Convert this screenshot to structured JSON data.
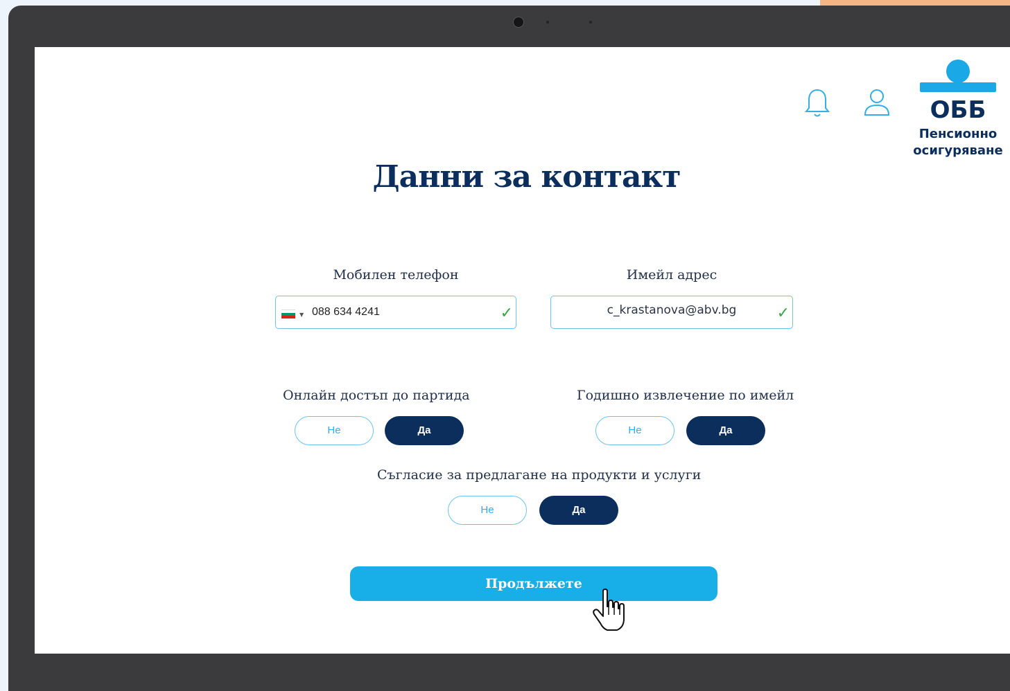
{
  "header": {
    "bell_icon": "bell-icon",
    "user_icon": "user-icon"
  },
  "logo": {
    "brand": "ОББ",
    "line1": "Пенсионно",
    "line2": "осигуряване"
  },
  "page": {
    "title": "Данни за контакт"
  },
  "form": {
    "phone": {
      "label": "Мобилен телефон",
      "value": "088 634 4241",
      "country_flag": "bg-flag-icon"
    },
    "email": {
      "label": "Имейл адрес",
      "value": "c_krastanova@abv.bg"
    },
    "online_access": {
      "label": "Онлайн достъп до партида",
      "no": "Не",
      "yes": "Да",
      "selected": "Да"
    },
    "annual_statement": {
      "label": "Годишно извлечение по имейл",
      "no": "Не",
      "yes": "Да",
      "selected": "Да"
    },
    "marketing_consent": {
      "label": "Съгласие за предлагане на продукти и услуги",
      "no": "Не",
      "yes": "Да",
      "selected": "Да"
    },
    "continue_label": "Продължете"
  },
  "colors": {
    "navy": "#0b2e5c",
    "accent_blue": "#18aee8",
    "check_green": "#3aa546"
  }
}
